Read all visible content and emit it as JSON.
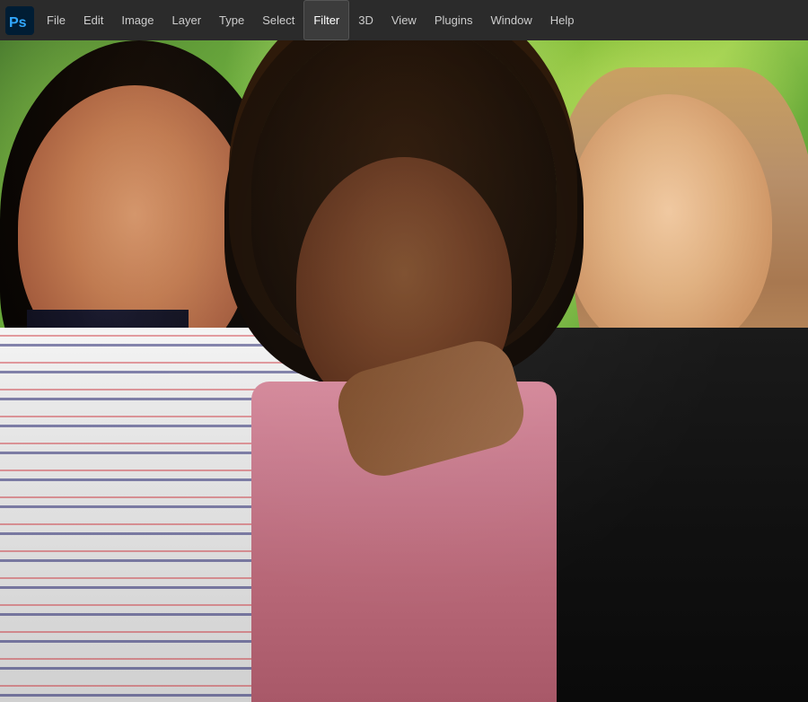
{
  "menuBar": {
    "items": [
      {
        "id": "file",
        "label": "File",
        "active": false
      },
      {
        "id": "edit",
        "label": "Edit",
        "active": false
      },
      {
        "id": "image",
        "label": "Image",
        "active": false
      },
      {
        "id": "layer",
        "label": "Layer",
        "active": false
      },
      {
        "id": "type",
        "label": "Type",
        "active": false
      },
      {
        "id": "select",
        "label": "Select",
        "active": false
      },
      {
        "id": "filter",
        "label": "Filter",
        "active": true
      },
      {
        "id": "3d",
        "label": "3D",
        "active": false
      },
      {
        "id": "view",
        "label": "View",
        "active": false
      },
      {
        "id": "plugins",
        "label": "Plugins",
        "active": false
      },
      {
        "id": "window",
        "label": "Window",
        "active": false
      },
      {
        "id": "help",
        "label": "Help",
        "active": false
      }
    ]
  },
  "canvas": {
    "description": "Photo of three women smiling outdoors"
  },
  "colors": {
    "menuBarBg": "#2b2b2b",
    "menuItemActive": "#3c3c3c",
    "menuItemText": "#cccccc",
    "menuItemActiveText": "#ffffff"
  }
}
